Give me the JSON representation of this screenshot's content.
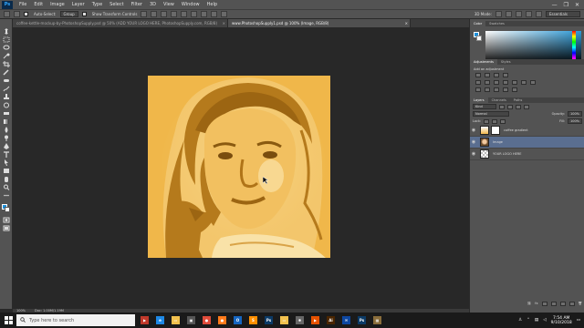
{
  "app": {
    "logo": "Ps"
  },
  "menu": {
    "items": [
      "File",
      "Edit",
      "Image",
      "Layer",
      "Type",
      "Select",
      "Filter",
      "3D",
      "View",
      "Window",
      "Help"
    ],
    "window_controls": [
      "—",
      "❐",
      "✕"
    ]
  },
  "options_bar": {
    "auto_select_label": "Auto-Select:",
    "auto_select_value": "Group",
    "show_transform_label": "Show Transform Controls",
    "mode_3d_label": "3D Mode:",
    "workspace": "Essentials"
  },
  "tabs": [
    {
      "label": "coffee-kettle-mockup-by-PhotoshopSupply.psd @ 50% (ADD YOUR LOGO HERE, PhotoshopSupply.com, RGB/8)",
      "active": false
    },
    {
      "label": "www.PhotoshopSupply1.psd @ 100% (Image, RGB/8)",
      "active": true
    }
  ],
  "status": {
    "zoom": "100%",
    "doc": "Doc: 1.00M/1.19M"
  },
  "panels": {
    "color_tabs": [
      "Color",
      "Swatches"
    ],
    "adjust_tabs": [
      "Adjustments",
      "Styles"
    ],
    "adjust_label": "Add an adjustment",
    "layers_tabs": [
      "Layers",
      "Channels",
      "Paths"
    ],
    "kind_label": "Kind",
    "blend_mode": "Normal",
    "opacity_label": "Opacity:",
    "opacity_value": "100%",
    "lock_label": "Lock:",
    "fill_label": "Fill:",
    "fill_value": "100%",
    "layers": [
      {
        "name": "coffee gradient",
        "selected": false
      },
      {
        "name": "Image",
        "selected": true
      },
      {
        "name": "YOUR LOGO HERE",
        "selected": false
      }
    ]
  },
  "taskbar": {
    "search_placeholder": "Type here to search",
    "time": "7:54 AM",
    "date": "9/10/2018",
    "apps": [
      {
        "icon": "film-icon",
        "glyph": "▶",
        "color": "#c0392b"
      },
      {
        "icon": "edge-icon",
        "glyph": "e",
        "color": "#1e88e5"
      },
      {
        "icon": "file-explorer-icon",
        "glyph": "▭",
        "color": "#f2c14e"
      },
      {
        "icon": "store-icon",
        "glyph": "▣",
        "color": "#555"
      },
      {
        "icon": "chrome-icon",
        "glyph": "●",
        "color": "#e04b3a"
      },
      {
        "icon": "firefox-icon",
        "glyph": "●",
        "color": "#ff7a1a"
      },
      {
        "icon": "outlook-icon",
        "glyph": "O",
        "color": "#1565c0"
      },
      {
        "icon": "sublime-icon",
        "glyph": "S",
        "color": "#ff8f00"
      },
      {
        "icon": "ps-taskbar-icon",
        "glyph": "Ps",
        "color": "#0b3a66"
      },
      {
        "icon": "explorer-icon",
        "glyph": "▭",
        "color": "#f2c14e"
      },
      {
        "icon": "gear-app-icon",
        "glyph": "✱",
        "color": "#666"
      },
      {
        "icon": "media-player-icon",
        "glyph": "▶",
        "color": "#e65100"
      },
      {
        "icon": "illustrator-icon",
        "glyph": "Ai",
        "color": "#4a2500"
      },
      {
        "icon": "mail-icon",
        "glyph": "✉",
        "color": "#0d47a1"
      },
      {
        "icon": "ps-active-icon",
        "glyph": "Ps",
        "color": "#0b3a66"
      },
      {
        "icon": "image-app-icon",
        "glyph": "▦",
        "color": "#8a6d3b"
      }
    ],
    "tray_icons": [
      "person-icon",
      "network-icon",
      "volume-icon",
      "keyboard-icon",
      "notification-icon"
    ]
  }
}
